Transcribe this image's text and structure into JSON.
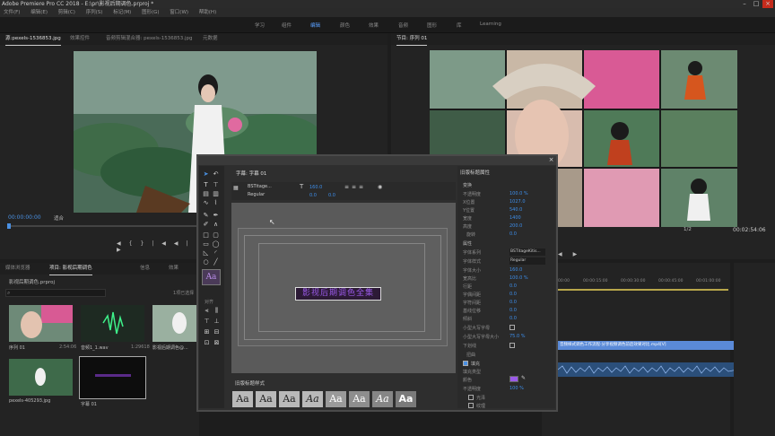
{
  "window": {
    "title": "Adobe Premiere Pro CC 2018 - E:\\pr\\影视后期调色.prproj *"
  },
  "menu": [
    "文件(F)",
    "编辑(E)",
    "剪辑(C)",
    "序列(S)",
    "标记(M)",
    "图形(G)",
    "窗口(W)",
    "帮助(H)"
  ],
  "workspaces": [
    "学习",
    "组件",
    "编辑",
    "颜色",
    "效果",
    "音频",
    "图形",
    "库",
    "Learning"
  ],
  "active_workspace": "编辑",
  "source_panel": {
    "tabs": [
      "源:pexels-1536853.jpg",
      "效果控件",
      "音频剪辑混合器: pexels-1536853.jpg",
      "元数据"
    ],
    "timecode": "00:00:00:00",
    "fit": "适合",
    "transport": [
      "◀",
      "{",
      "}",
      "|◀",
      "◀|",
      "▶",
      "|▶"
    ]
  },
  "program_panel": {
    "tab": "节目: 序列 01",
    "duration": "00:02:54:06",
    "resolution": "1/2",
    "transport": [
      "◀",
      "{",
      "}",
      "▶"
    ]
  },
  "project_panel": {
    "tabs": [
      "媒体浏览器",
      "项目: 影视后期调色",
      "信息",
      "效果"
    ],
    "path": "影视后期调色.prproj",
    "selected_count": "1项已选择",
    "items": [
      {
        "name": "序列 01",
        "meta": "2:54:06"
      },
      {
        "name": "音频1_1.wav",
        "meta": "1:29618"
      },
      {
        "name": "影视后期调色@...",
        "meta": ""
      },
      {
        "name": "pexels-405293.jpg",
        "meta": ""
      },
      {
        "name": "字幕 01",
        "meta": ""
      }
    ]
  },
  "timeline": {
    "ruler": [
      "00:00",
      "00:00:15:00",
      "00:00:30:00",
      "00:00:45:00",
      "00:01:00:00"
    ],
    "clip_label": "音频样式调色工作流程·分享视频调色前后效果对比.mp4[V]"
  },
  "title_dialog": {
    "tab": "字幕: 字幕 01",
    "font": "BSTitage...",
    "style": "Regular",
    "size": "160.0",
    "leading": "0.0",
    "kerning": "0.0",
    "title_text": "影视后期调色全集",
    "styles_tab": "旧版标题样式",
    "style_sample": "Aa",
    "actions_tab": "对齐",
    "props_tab": "旧版标题属性",
    "transform_label": "变换",
    "transform": [
      {
        "label": "不透明度",
        "value": "100.0 %"
      },
      {
        "label": "X位置",
        "value": "1027.0"
      },
      {
        "label": "Y位置",
        "value": "540.0"
      },
      {
        "label": "宽度",
        "value": "1400"
      },
      {
        "label": "高度",
        "value": "200.0"
      },
      {
        "label": "旋转",
        "value": "0.0"
      }
    ],
    "attributes_label": "属性",
    "attributes": [
      {
        "label": "字体系列",
        "value": "BSTitageKitis..."
      },
      {
        "label": "字体样式",
        "value": "Regular"
      },
      {
        "label": "字体大小",
        "value": "160.0"
      },
      {
        "label": "宽高比",
        "value": "100.0 %"
      },
      {
        "label": "行距",
        "value": "0.0"
      },
      {
        "label": "字偶间距",
        "value": "0.0"
      },
      {
        "label": "字符间距",
        "value": "0.0"
      },
      {
        "label": "基线位移",
        "value": "0.0"
      },
      {
        "label": "倾斜",
        "value": "0.0"
      },
      {
        "label": "小型大写字母",
        "value": ""
      },
      {
        "label": "小型大写字母大小",
        "value": "75.0 %"
      },
      {
        "label": "下划线",
        "value": ""
      },
      {
        "label": "扭曲",
        "value": ""
      }
    ],
    "fill_label": "填充",
    "fill": [
      {
        "label": "填充类型",
        "value": ""
      },
      {
        "label": "颜色",
        "value": ""
      },
      {
        "label": "不透明度",
        "value": "100 %"
      },
      {
        "label": "光泽",
        "value": ""
      },
      {
        "label": "纹理",
        "value": ""
      }
    ],
    "text_color": "#9a5ae8"
  },
  "colors": {
    "accent": "#4a90e2",
    "highlight_clip": "#5a8ad8"
  }
}
